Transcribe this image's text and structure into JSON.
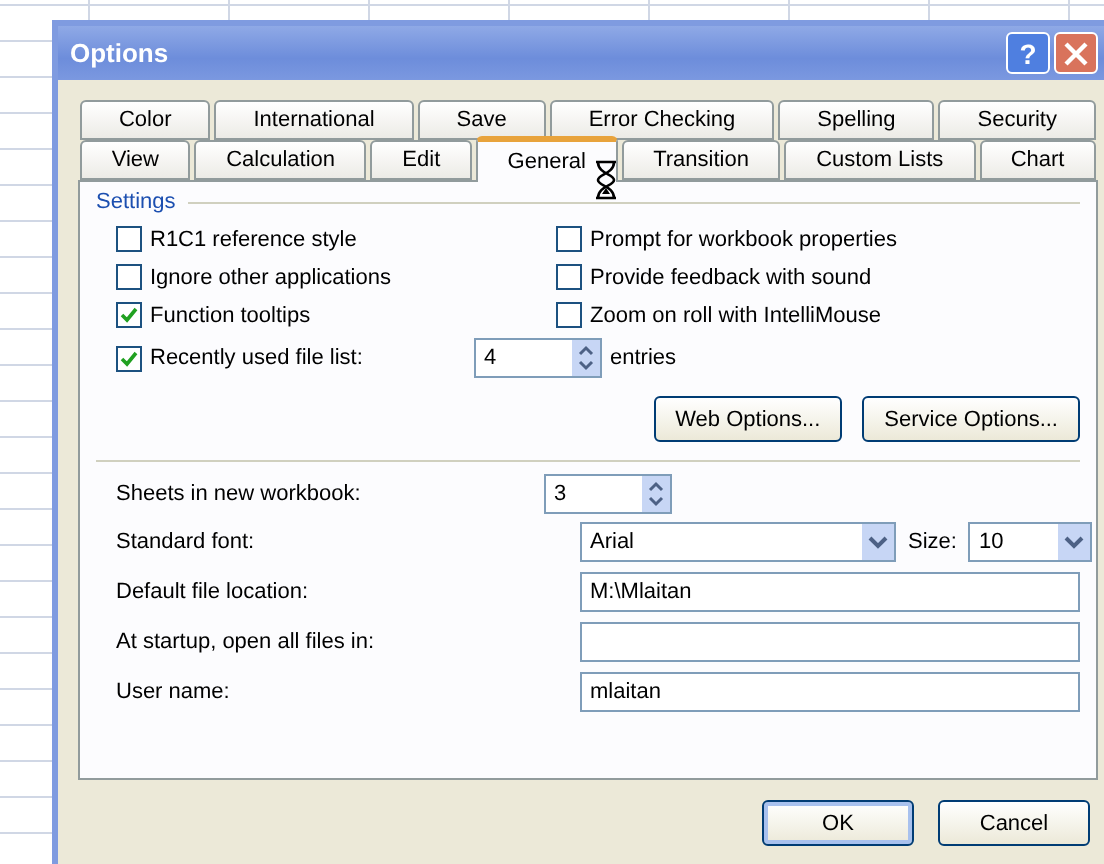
{
  "window": {
    "title": "Options",
    "help": "?"
  },
  "tab_rows": [
    [
      {
        "label": "Color",
        "selected": false
      },
      {
        "label": "International",
        "selected": false
      },
      {
        "label": "Save",
        "selected": false
      },
      {
        "label": "Error Checking",
        "selected": false
      },
      {
        "label": "Spelling",
        "selected": false
      },
      {
        "label": "Security",
        "selected": false
      }
    ],
    [
      {
        "label": "View",
        "selected": false
      },
      {
        "label": "Calculation",
        "selected": false
      },
      {
        "label": "Edit",
        "selected": false
      },
      {
        "label": "General",
        "selected": true
      },
      {
        "label": "Transition",
        "selected": false
      },
      {
        "label": "Custom Lists",
        "selected": false
      },
      {
        "label": "Chart",
        "selected": false
      }
    ]
  ],
  "settings": {
    "title": "Settings",
    "checkboxes": [
      {
        "label": "R1C1 reference style",
        "checked": false
      },
      {
        "label": "Prompt for workbook properties",
        "checked": false
      },
      {
        "label": "Ignore other applications",
        "checked": false
      },
      {
        "label": "Provide feedback with sound",
        "checked": false
      },
      {
        "label": "Function tooltips",
        "checked": true
      },
      {
        "label": "Zoom on roll with IntelliMouse",
        "checked": false
      }
    ],
    "recent_files": {
      "label": "Recently used file list:",
      "checked": true,
      "value": "4",
      "suffix": "entries"
    },
    "buttons": [
      "Web Options...",
      "Service Options..."
    ]
  },
  "fields": [
    {
      "kind": "spinner",
      "label": "Sheets in new workbook:",
      "value": "3"
    },
    {
      "kind": "font",
      "label": "Standard font:",
      "value": "Arial",
      "size_label": "Size:",
      "size_value": "10"
    },
    {
      "kind": "text",
      "label": "Default file location:",
      "value": "M:\\Mlaitan"
    },
    {
      "kind": "text",
      "label": "At startup, open all files in:"
    },
    {
      "kind": "text",
      "label": "User name:",
      "value": "mlaitan"
    }
  ],
  "footer_buttons": [
    {
      "label": "OK",
      "default": true
    },
    {
      "label": "Cancel",
      "default": false
    }
  ]
}
